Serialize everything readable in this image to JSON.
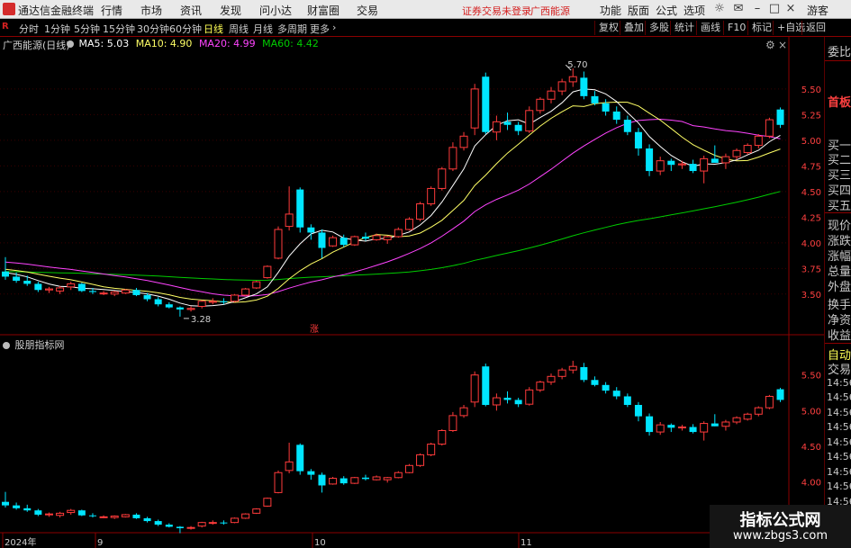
{
  "menubar": {
    "app_title": "通达信金融终端",
    "menus": [
      "行情",
      "市场",
      "资讯",
      "发现",
      "问小达",
      "财富圈",
      "交易"
    ],
    "status_text": "证券交易未登录",
    "stock_name": "广西能源",
    "right_items": [
      "功能",
      "版面",
      "公式",
      "选项"
    ],
    "user": "游客"
  },
  "toolbar": {
    "periods": [
      "分时",
      "1分钟",
      "5分钟",
      "15分钟",
      "30分钟",
      "60分钟",
      "日线",
      "周线",
      "月线",
      "多周期",
      "更多"
    ],
    "active_period": "日线",
    "buttons": [
      "复权",
      "叠加",
      "多股",
      "统计",
      "画线",
      "F10",
      "标记",
      "+自选",
      "返回"
    ],
    "r_badge": "R"
  },
  "main_chart": {
    "title": "广西能源(日线)",
    "ma5_label": "MA5: 5.03",
    "ma10_label": "MA10: 4.90",
    "ma20_label": "MA20: 4.99",
    "ma60_label": "MA60: 4.42",
    "high_annotation": "5.70",
    "low_annotation": "3.28",
    "limit_marker": "涨",
    "colors": {
      "ma5": "#ffffff",
      "ma10": "#ffff66",
      "ma20": "#ff44ff",
      "ma60": "#00cc00",
      "up": "#ff3b3b",
      "down": "#00e5ff"
    }
  },
  "sub_chart": {
    "title": "股朋指标网"
  },
  "axis": {
    "main_ticks": [
      "5.50",
      "5.25",
      "5.00",
      "4.75",
      "4.50",
      "4.25",
      "4.00",
      "3.75",
      "3.50"
    ],
    "sub_ticks": [
      "5.50",
      "5.00",
      "4.50",
      "4.00"
    ],
    "dates": [
      "2024年",
      "9",
      "10",
      "11"
    ]
  },
  "chart_data": {
    "type": "candlestick",
    "ylim": [
      3.2,
      5.85
    ],
    "ohlc": [
      [
        3.72,
        3.86,
        3.64,
        3.67
      ],
      [
        3.67,
        3.71,
        3.61,
        3.63
      ],
      [
        3.63,
        3.68,
        3.58,
        3.6
      ],
      [
        3.6,
        3.62,
        3.52,
        3.54
      ],
      [
        3.54,
        3.57,
        3.51,
        3.55
      ],
      [
        3.53,
        3.58,
        3.5,
        3.56
      ],
      [
        3.57,
        3.62,
        3.54,
        3.6
      ],
      [
        3.6,
        3.61,
        3.52,
        3.53
      ],
      [
        3.53,
        3.56,
        3.5,
        3.52
      ],
      [
        3.51,
        3.53,
        3.49,
        3.51
      ],
      [
        3.5,
        3.53,
        3.48,
        3.52
      ],
      [
        3.51,
        3.55,
        3.5,
        3.54
      ],
      [
        3.54,
        3.56,
        3.48,
        3.49
      ],
      [
        3.49,
        3.51,
        3.43,
        3.45
      ],
      [
        3.45,
        3.47,
        3.38,
        3.4
      ],
      [
        3.4,
        3.42,
        3.36,
        3.37
      ],
      [
        3.37,
        3.38,
        3.28,
        3.35
      ],
      [
        3.35,
        3.38,
        3.33,
        3.36
      ],
      [
        3.38,
        3.44,
        3.36,
        3.43
      ],
      [
        3.42,
        3.46,
        3.4,
        3.43
      ],
      [
        3.43,
        3.46,
        3.4,
        3.42
      ],
      [
        3.43,
        3.5,
        3.42,
        3.49
      ],
      [
        3.49,
        3.56,
        3.48,
        3.55
      ],
      [
        3.56,
        3.63,
        3.55,
        3.62
      ],
      [
        3.66,
        3.78,
        3.65,
        3.77
      ],
      [
        3.85,
        4.16,
        3.84,
        4.13
      ],
      [
        4.16,
        4.55,
        4.12,
        4.28
      ],
      [
        4.52,
        4.54,
        4.1,
        4.15
      ],
      [
        4.15,
        4.18,
        4.03,
        4.1
      ],
      [
        4.1,
        4.13,
        3.85,
        3.95
      ],
      [
        3.97,
        4.07,
        3.96,
        4.05
      ],
      [
        4.05,
        4.08,
        3.96,
        3.98
      ],
      [
        3.98,
        4.07,
        3.97,
        4.06
      ],
      [
        4.06,
        4.1,
        4.02,
        4.04
      ],
      [
        4.03,
        4.09,
        4.02,
        4.07
      ],
      [
        4.03,
        4.07,
        3.99,
        4.06
      ],
      [
        4.06,
        4.15,
        4.05,
        4.13
      ],
      [
        4.13,
        4.25,
        4.12,
        4.23
      ],
      [
        4.23,
        4.4,
        4.21,
        4.38
      ],
      [
        4.38,
        4.55,
        4.36,
        4.53
      ],
      [
        4.53,
        4.74,
        4.51,
        4.72
      ],
      [
        4.72,
        4.98,
        4.7,
        4.93
      ],
      [
        4.93,
        5.08,
        4.9,
        5.04
      ],
      [
        5.12,
        5.55,
        5.05,
        5.5
      ],
      [
        5.62,
        5.66,
        5.06,
        5.08
      ],
      [
        5.08,
        5.24,
        5.0,
        5.18
      ],
      [
        5.18,
        5.27,
        5.1,
        5.15
      ],
      [
        5.15,
        5.18,
        5.05,
        5.09
      ],
      [
        5.09,
        5.33,
        5.07,
        5.29
      ],
      [
        5.29,
        5.42,
        5.26,
        5.4
      ],
      [
        5.4,
        5.52,
        5.36,
        5.48
      ],
      [
        5.48,
        5.6,
        5.44,
        5.57
      ],
      [
        5.57,
        5.7,
        5.52,
        5.62
      ],
      [
        5.61,
        5.67,
        5.4,
        5.43
      ],
      [
        5.43,
        5.48,
        5.34,
        5.36
      ],
      [
        5.36,
        5.4,
        5.24,
        5.28
      ],
      [
        5.28,
        5.33,
        5.16,
        5.2
      ],
      [
        5.2,
        5.24,
        5.05,
        5.08
      ],
      [
        5.08,
        5.12,
        4.85,
        4.92
      ],
      [
        4.92,
        4.96,
        4.65,
        4.7
      ],
      [
        4.7,
        4.84,
        4.66,
        4.8
      ],
      [
        4.8,
        4.82,
        4.7,
        4.76
      ],
      [
        4.76,
        4.8,
        4.72,
        4.77
      ],
      [
        4.77,
        4.81,
        4.68,
        4.7
      ],
      [
        4.7,
        4.85,
        4.58,
        4.82
      ],
      [
        4.82,
        4.95,
        4.78,
        4.78
      ],
      [
        4.78,
        4.87,
        4.72,
        4.84
      ],
      [
        4.84,
        4.92,
        4.81,
        4.9
      ],
      [
        4.88,
        4.97,
        4.86,
        4.95
      ],
      [
        4.95,
        5.06,
        4.92,
        5.04
      ],
      [
        5.04,
        5.22,
        5.02,
        5.2
      ],
      [
        5.3,
        5.32,
        5.12,
        5.15
      ]
    ]
  }
}
